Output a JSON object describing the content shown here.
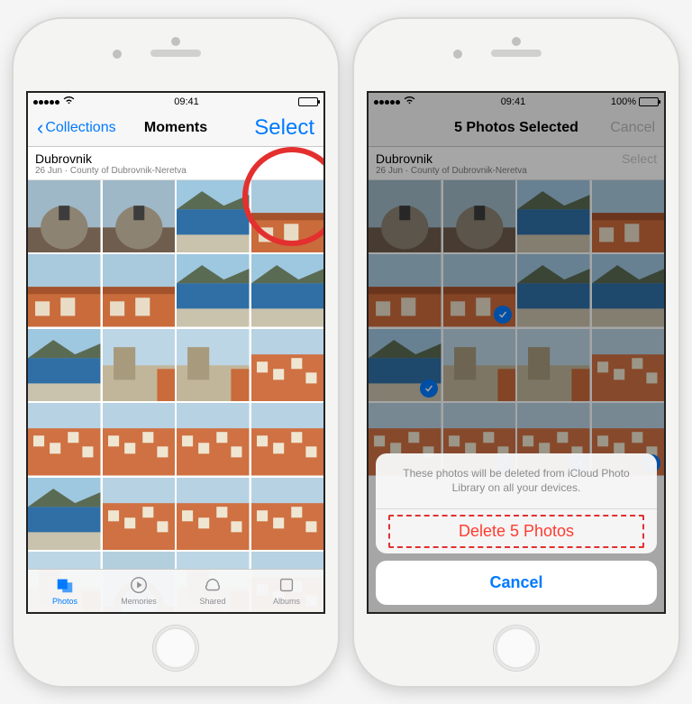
{
  "status": {
    "time": "09:41",
    "battery": "100%"
  },
  "left": {
    "back": "Collections",
    "title": "Moments",
    "select": "Select",
    "location": "Dubrovnik",
    "subtitle": "26 Jun · County of Dubrovnik-Neretva",
    "tabs": {
      "photos": "Photos",
      "memories": "Memories",
      "shared": "Shared",
      "albums": "Albums"
    }
  },
  "right": {
    "title": "5 Photos Selected",
    "cancel_nav": "Cancel",
    "location": "Dubrovnik",
    "subtitle": "26 Jun · County of Dubrovnik-Neretva",
    "section_select": "Select",
    "sheet_msg": "These photos will be deleted from iCloud Photo Library on all your devices.",
    "delete": "Delete 5 Photos",
    "cancel": "Cancel"
  },
  "selected_indexes": [
    5,
    8,
    13,
    14,
    15
  ]
}
